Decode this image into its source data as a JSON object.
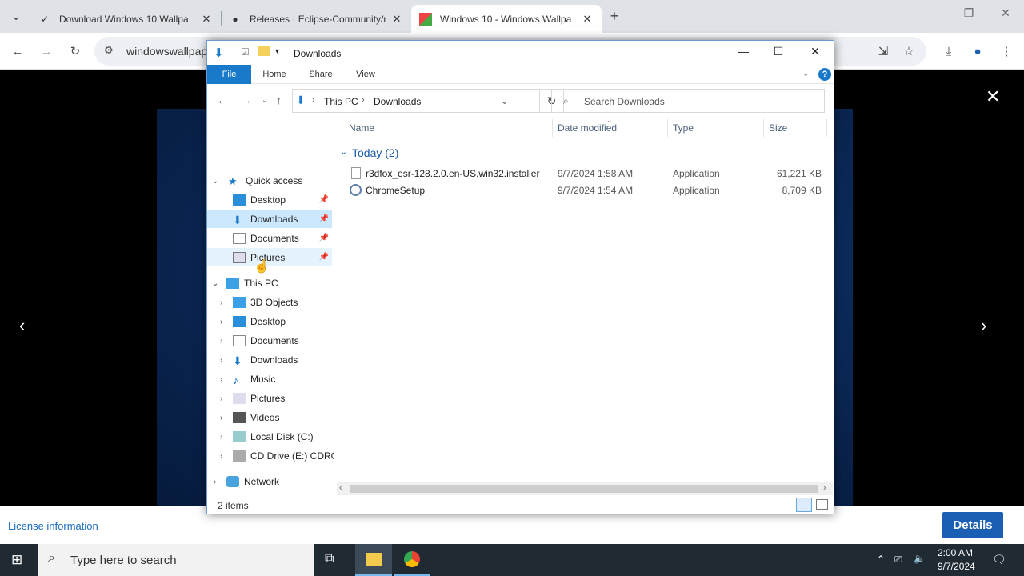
{
  "browser": {
    "tabs": [
      {
        "title": "Download Windows 10 Wallpa",
        "active": false
      },
      {
        "title": "Releases · Eclipse-Community/r",
        "active": false
      },
      {
        "title": "Windows 10 - Windows Wallpa",
        "active": true
      }
    ],
    "url": "windowswallpap"
  },
  "page": {
    "license_link": "License information",
    "details_button": "Details"
  },
  "explorer": {
    "title": "Downloads",
    "ribbon_tabs": [
      "File",
      "Home",
      "Share",
      "View"
    ],
    "help": "?",
    "address": {
      "root": "This PC",
      "folder": "Downloads"
    },
    "search_placeholder": "Search Downloads",
    "nav": {
      "quick_access": "Quick access",
      "quick_items": [
        "Desktop",
        "Downloads",
        "Documents",
        "Pictures"
      ],
      "this_pc": "This PC",
      "pc_items": [
        "3D Objects",
        "Desktop",
        "Documents",
        "Downloads",
        "Music",
        "Pictures",
        "Videos",
        "Local Disk (C:)",
        "CD Drive (E:) CDROI"
      ],
      "network": "Network"
    },
    "columns": [
      "Name",
      "Date modified",
      "Type",
      "Size"
    ],
    "group": "Today (2)",
    "files": [
      {
        "name": "r3dfox_esr-128.2.0.en-US.win32.installer",
        "date": "9/7/2024 1:58 AM",
        "type": "Application",
        "size": "61,221 KB"
      },
      {
        "name": "ChromeSetup",
        "date": "9/7/2024 1:54 AM",
        "type": "Application",
        "size": "8,709 KB"
      }
    ],
    "status": "2 items"
  },
  "taskbar": {
    "search_placeholder": "Type here to search",
    "time": "2:00 AM",
    "date": "9/7/2024"
  },
  "colors": {
    "file_tab": "#1979ca",
    "details": "#1a5fb4",
    "taskbar": "#1f2a33",
    "selected": "#cce8ff"
  }
}
